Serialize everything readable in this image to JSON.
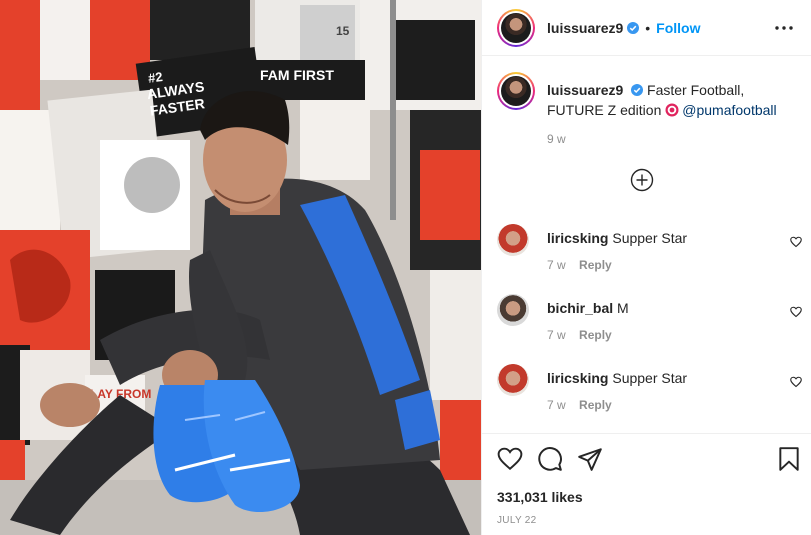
{
  "post": {
    "author": {
      "username": "luissuarez9",
      "verified": true,
      "follow_label": "Follow",
      "separator": "•"
    },
    "caption": {
      "username": "luissuarez9",
      "text": "Faster Football, FUTURE Z edition",
      "mention": "@pumafootball",
      "time": "9 w"
    },
    "photo": {
      "wall_texts": {
        "always_faster_1": "#2",
        "always_faster_2": "ALWAYS",
        "always_faster_3": "FASTER",
        "fam_first": "FAM FIRST",
        "play_from": "LAY FROM",
        "shirt_number": "15"
      }
    },
    "comments": [
      {
        "username": "liricsking",
        "text": "Supper Star",
        "time": "7 w",
        "reply_label": "Reply"
      },
      {
        "username": "bichir_bal",
        "text": "M",
        "time": "7 w",
        "reply_label": "Reply"
      },
      {
        "username": "liricsking",
        "text": "Supper Star",
        "time": "7 w",
        "reply_label": "Reply"
      }
    ],
    "likes_label": "331,031 likes",
    "date_label": "JULY 22"
  },
  "icons": {
    "verified": "verified-badge-icon",
    "more": "more-options-icon",
    "load_more": "plus-circle-icon",
    "like": "heart-icon",
    "comment": "comment-bubble-icon",
    "share": "paper-plane-icon",
    "save": "bookmark-icon",
    "target": "target-emoji-icon"
  },
  "colors": {
    "accent": "#0095f6",
    "text": "#262626",
    "muted": "#8e8e8e",
    "divider": "#efefef",
    "boot_blue": "#2f7ee8",
    "jacket_blue": "#2e6fd8",
    "wall_red": "#e4412b"
  }
}
